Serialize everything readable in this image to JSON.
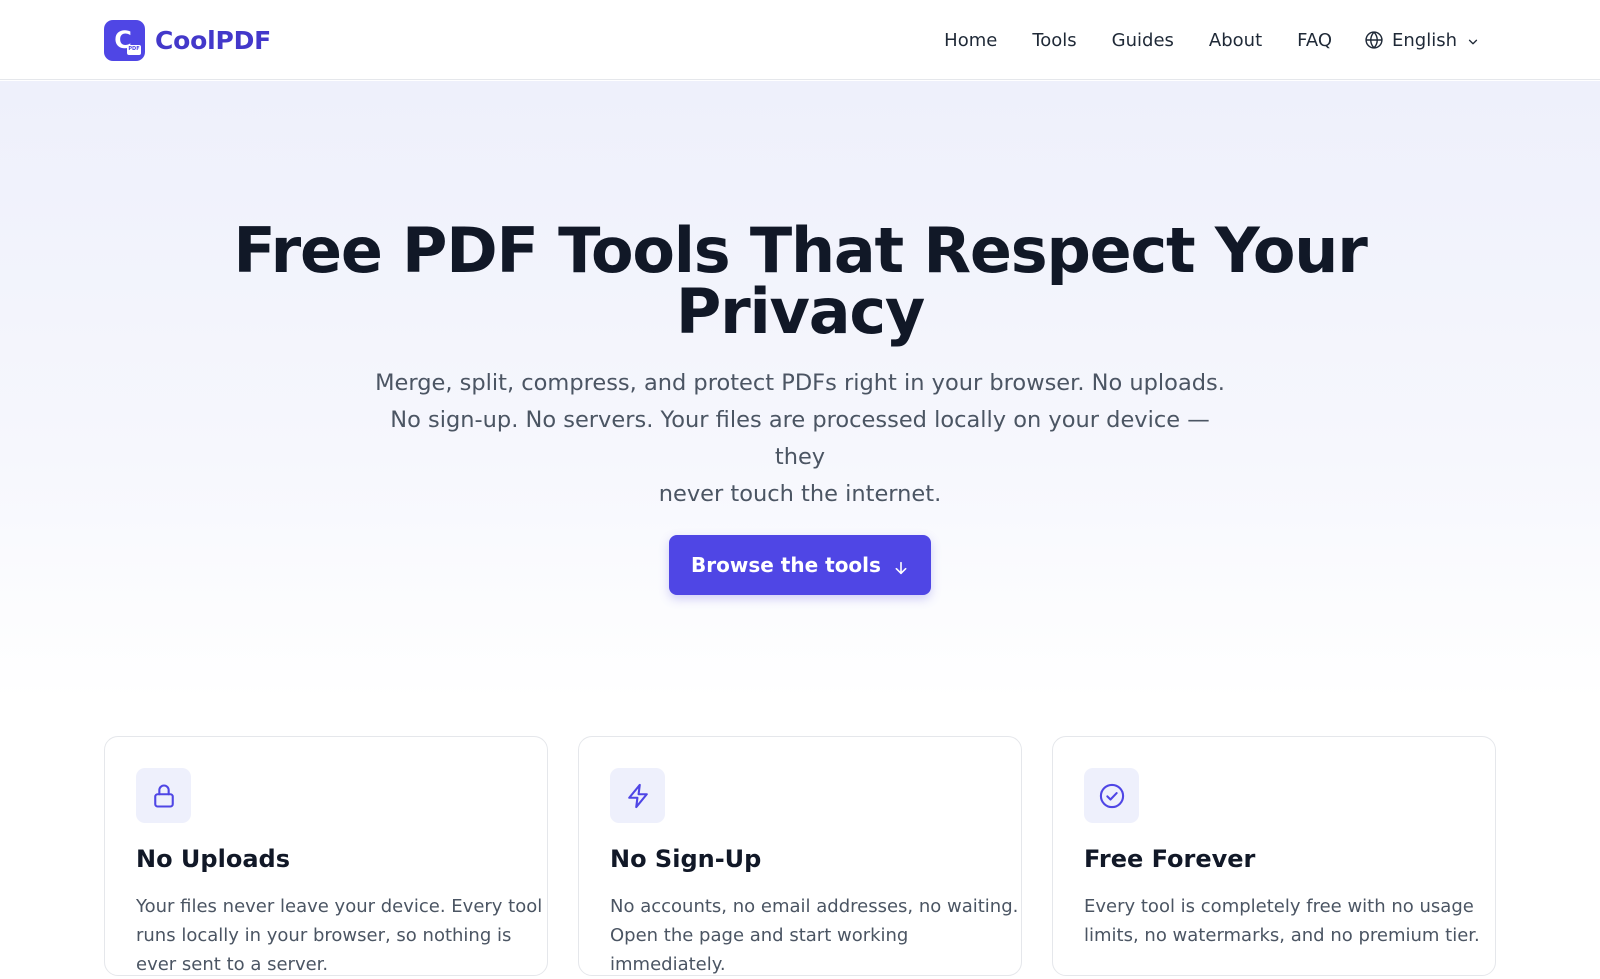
{
  "header": {
    "brand": {
      "icon_letter": "C",
      "icon_tag": "PDF",
      "name": "CoolPDF"
    },
    "nav": [
      "Home",
      "Tools",
      "Guides",
      "About",
      "FAQ"
    ],
    "language": {
      "icon": "globe-icon",
      "label": "English",
      "chevron": "chevron-down-icon"
    }
  },
  "hero": {
    "title_lines": [
      "Free PDF Tools That Respect Your",
      "Privacy"
    ],
    "subtitle_lines": [
      "Merge, split, compress, and protect PDFs right in your browser. No uploads.",
      "No sign-up. No servers. Your files are processed locally on your device — they",
      "never touch the internet."
    ],
    "cta": {
      "label": "Browse the tools",
      "icon": "arrow-down-icon"
    }
  },
  "features": [
    {
      "icon": "lock-icon",
      "title": "No Uploads",
      "text_lines": [
        "Your files never leave your device. Every tool",
        "runs locally in your browser, so nothing is",
        "ever sent to a server."
      ]
    },
    {
      "icon": "lightning-icon",
      "title": "No Sign-Up",
      "text_lines": [
        "No accounts, no email addresses, no waiting.",
        "Open the page and start working",
        "immediately."
      ]
    },
    {
      "icon": "check-circle-icon",
      "title": "Free Forever",
      "text_lines": [
        "Every tool is completely free with no usage",
        "limits, no watermarks, and no premium tier."
      ]
    }
  ],
  "colors": {
    "accent": "#4f46e5",
    "brand_text": "#4338ca",
    "heading": "#111827",
    "body_text": "#4b5563",
    "icon_bg": "#eef0fc",
    "hero_bg_top": "#eef0fb"
  }
}
